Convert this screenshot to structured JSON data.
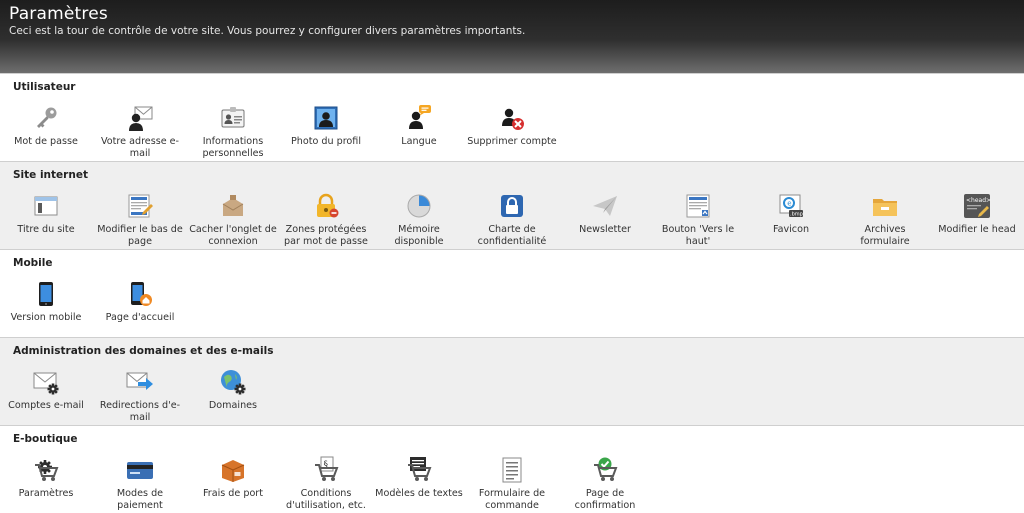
{
  "header": {
    "title": "Paramètres",
    "subtitle": "Ceci est la tour de contrôle de votre site. Vous pourrez y configurer divers paramètres importants."
  },
  "sections": [
    {
      "title": "Utilisateur",
      "items": [
        {
          "label": "Mot de passe",
          "icon": "key-icon"
        },
        {
          "label": "Votre adresse e-mail",
          "icon": "user-mail-icon"
        },
        {
          "label": "Informations personnelles",
          "icon": "id-card-icon"
        },
        {
          "label": "Photo du profil",
          "icon": "profile-photo-icon"
        },
        {
          "label": "Langue",
          "icon": "user-speech-icon"
        },
        {
          "label": "Supprimer compte",
          "icon": "user-delete-icon"
        }
      ]
    },
    {
      "title": "Site internet",
      "items": [
        {
          "label": "Titre du site",
          "icon": "window-title-icon"
        },
        {
          "label": "Modifier le bas de page",
          "icon": "page-footer-edit-icon"
        },
        {
          "label": "Cacher l'onglet de connexion",
          "icon": "hide-tab-icon"
        },
        {
          "label": "Zones protégées par mot de passe",
          "icon": "padlock-icon"
        },
        {
          "label": "Mémoire disponible",
          "icon": "pie-chart-icon"
        },
        {
          "label": "Charte de confidentialité",
          "icon": "privacy-lock-icon"
        },
        {
          "label": "Newsletter",
          "icon": "paper-plane-icon"
        },
        {
          "label": "Bouton 'Vers le haut'",
          "icon": "back-to-top-icon"
        },
        {
          "label": "Favicon",
          "icon": "favicon-icon"
        },
        {
          "label": "Archives formulaire",
          "icon": "folder-icon"
        },
        {
          "label": "Modifier le head",
          "icon": "head-tag-icon"
        }
      ]
    },
    {
      "title": "Mobile",
      "items": [
        {
          "label": "Version mobile",
          "icon": "smartphone-icon"
        },
        {
          "label": "Page d'accueil",
          "icon": "phone-home-icon"
        }
      ]
    },
    {
      "title": "Administration des domaines et des e-mails",
      "items": [
        {
          "label": "Comptes e-mail",
          "icon": "mail-settings-icon"
        },
        {
          "label": "Redirections d'e-mail",
          "icon": "mail-forward-icon"
        },
        {
          "label": "Domaines",
          "icon": "globe-settings-icon"
        }
      ]
    },
    {
      "title": "E-boutique",
      "items": [
        {
          "label": "Paramètres",
          "icon": "cart-gear-icon"
        },
        {
          "label": "Modes de paiement",
          "icon": "credit-card-icon"
        },
        {
          "label": "Frais de port",
          "icon": "shipping-box-icon"
        },
        {
          "label": "Conditions d'utilisation, etc.",
          "icon": "cart-terms-icon"
        },
        {
          "label": "Modèles de textes",
          "icon": "cart-text-icon"
        },
        {
          "label": "Formulaire de commande",
          "icon": "order-form-icon"
        },
        {
          "label": "Page de confirmation",
          "icon": "cart-check-icon"
        }
      ]
    }
  ]
}
